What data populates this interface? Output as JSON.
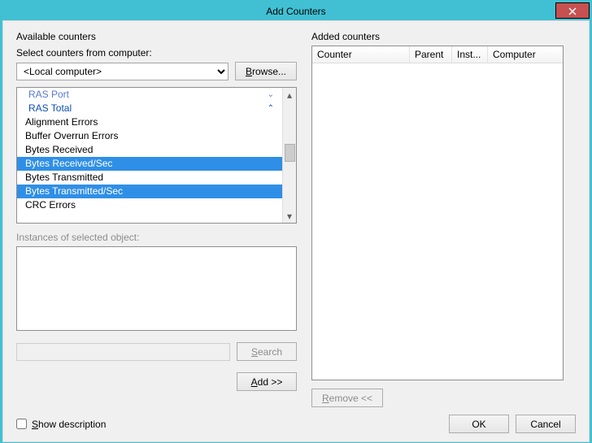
{
  "window": {
    "title": "Add Counters"
  },
  "left": {
    "group_label": "Available counters",
    "select_label": "Select counters from computer:",
    "computer_option": "<Local computer>",
    "browse": "Browse...",
    "counter_groups": {
      "ras_port": "RAS Port",
      "ras_total": "RAS Total"
    },
    "counters": {
      "alignment_errors": "Alignment Errors",
      "buffer_overrun": "Buffer Overrun Errors",
      "bytes_received": "Bytes Received",
      "bytes_received_sec": "Bytes Received/Sec",
      "bytes_transmitted": "Bytes Transmitted",
      "bytes_transmitted_sec": "Bytes Transmitted/Sec",
      "crc_errors": "CRC Errors"
    },
    "instances_label": "Instances of selected object:",
    "search": "Search",
    "add": "Add >>"
  },
  "right": {
    "group_label": "Added counters",
    "headers": {
      "counter": "Counter",
      "parent": "Parent",
      "inst": "Inst...",
      "computer": "Computer"
    },
    "remove": "Remove <<"
  },
  "footer": {
    "show_desc": "Show description",
    "ok": "OK",
    "cancel": "Cancel"
  }
}
